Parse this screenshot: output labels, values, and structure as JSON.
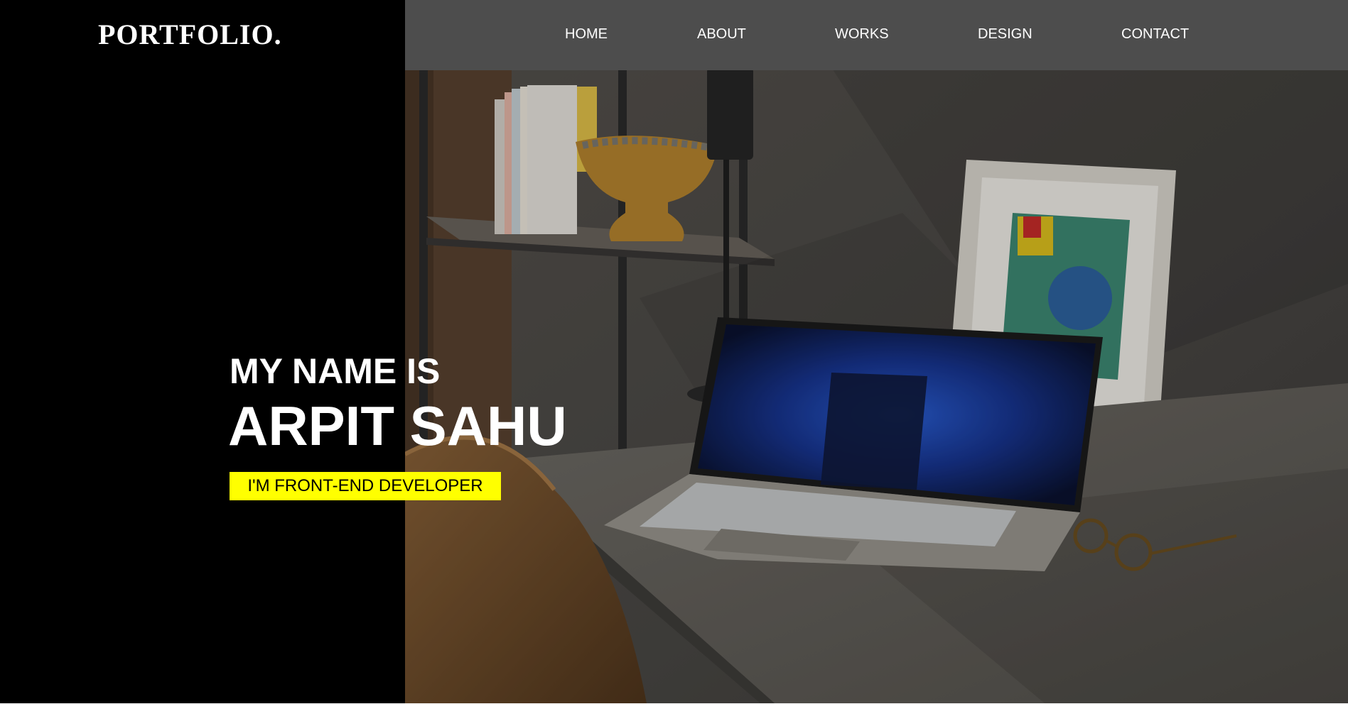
{
  "brand": {
    "logo_text": "PORTFOLIO."
  },
  "nav": {
    "items": [
      {
        "label": "HOME"
      },
      {
        "label": "ABOUT"
      },
      {
        "label": "WORKS"
      },
      {
        "label": "DESIGN"
      },
      {
        "label": "CONTACT"
      }
    ]
  },
  "hero": {
    "greeting": "MY NAME IS",
    "name": "ARPIT SAHU",
    "role": "I'M FRONT-END DEVELOPER",
    "background_image": "desk-workspace-photo"
  },
  "colors": {
    "left_panel": "#000000",
    "navbar": "#4d4d4d",
    "text": "#ffffff",
    "badge": "#ffff00",
    "badge_text": "#000000"
  }
}
